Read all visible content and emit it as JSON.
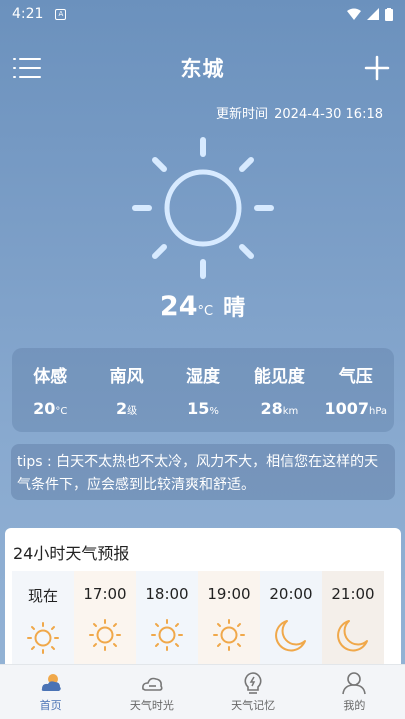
{
  "status_bar": {
    "time": "4:21",
    "sim_label": "A"
  },
  "header": {
    "city": "东城",
    "menu_icon": "list-icon",
    "add_icon": "plus-icon"
  },
  "updated": {
    "label": "更新时间",
    "datetime": "2024-4-30 16:18"
  },
  "current": {
    "temp": "24",
    "unit": "°C",
    "condition": "晴",
    "icon": "sun-icon"
  },
  "details": [
    {
      "label": "体感",
      "value": "20",
      "unit": "°C"
    },
    {
      "label": "南风",
      "value": "2",
      "unit": "级"
    },
    {
      "label": "湿度",
      "value": "15",
      "unit": "%"
    },
    {
      "label": "能见度",
      "value": "28",
      "unit": "km"
    },
    {
      "label": "气压",
      "value": "1007",
      "unit": "hPa"
    }
  ],
  "tips": "tips : 白天不太热也不太冷，风力不大，相信您在这样的天气条件下，应会感到比较清爽和舒适。",
  "forecast": {
    "title": "24小时天气预报",
    "hours": [
      {
        "time": "现在",
        "icon": "sun-icon"
      },
      {
        "time": "17:00",
        "icon": "sun-icon"
      },
      {
        "time": "18:00",
        "icon": "sun-icon"
      },
      {
        "time": "19:00",
        "icon": "sun-icon"
      },
      {
        "time": "20:00",
        "icon": "moon-icon"
      },
      {
        "time": "21:00",
        "icon": "moon-icon"
      }
    ]
  },
  "nav": [
    {
      "label": "首页",
      "icon": "home-weather-icon",
      "active": true
    },
    {
      "label": "天气时光",
      "icon": "cloud-icon",
      "active": false
    },
    {
      "label": "天气记忆",
      "icon": "bulb-icon",
      "active": false
    },
    {
      "label": "我的",
      "icon": "user-icon",
      "active": false
    }
  ],
  "colors": {
    "accent": "#4a73b5",
    "sun_orange": "#f0a84a",
    "bg_top": "#6b91bd"
  }
}
